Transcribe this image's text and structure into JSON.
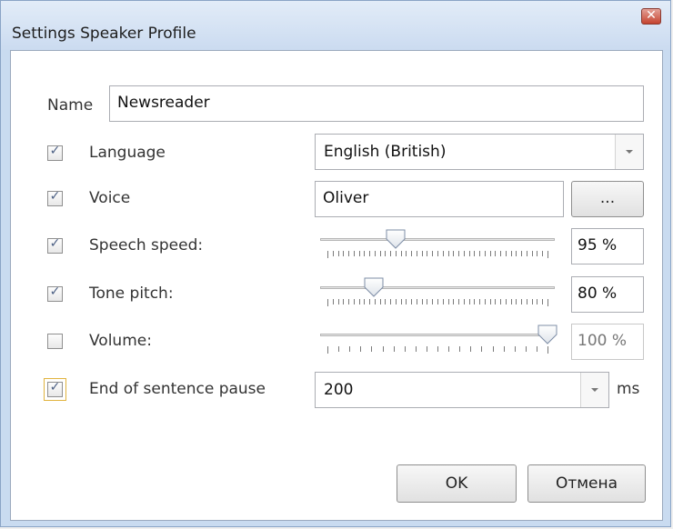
{
  "window": {
    "title": "Settings Speaker Profile"
  },
  "name_row": {
    "label": "Name",
    "value": "Newsreader"
  },
  "language": {
    "label": "Language",
    "checked": true,
    "value": "English (British)"
  },
  "voice": {
    "label": "Voice",
    "checked": true,
    "value": "Oliver",
    "browse_label": "..."
  },
  "speech_speed": {
    "label": "Speech speed:",
    "checked": true,
    "value_text": "95 %",
    "level": 0.31
  },
  "tone_pitch": {
    "label": "Tone pitch:",
    "checked": true,
    "value_text": "80 %",
    "level": 0.21
  },
  "volume": {
    "label": "Volume:",
    "checked": false,
    "value_text": "100 %",
    "level": 1.0
  },
  "pause": {
    "label": "End of sentence pause",
    "checked": true,
    "value": "200",
    "unit": "ms"
  },
  "buttons": {
    "ok": "OK",
    "cancel": "Отмена"
  }
}
